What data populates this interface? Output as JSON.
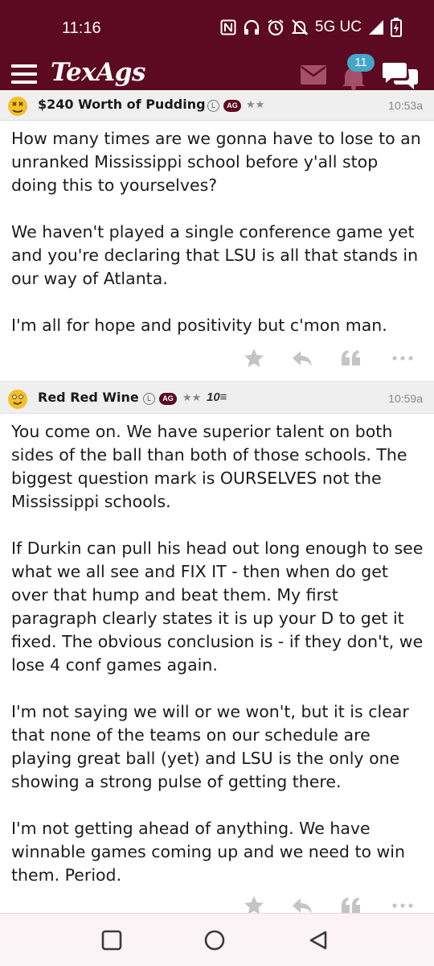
{
  "status_bar": {
    "time": "11:16",
    "network": "5G UC",
    "icons": [
      "nfc-icon",
      "headphones-icon",
      "alarm-icon",
      "mute-icon",
      "signal-icon",
      "battery-charging-icon"
    ]
  },
  "app_bar": {
    "menu_icon": "hamburger-icon",
    "logo": "TexAgs",
    "notifications_count": "11",
    "icons": [
      "mail-icon",
      "bell-icon",
      "chat-icon"
    ]
  },
  "posts": [
    {
      "username": "$240 Worth of Pudding",
      "badge_l": "L",
      "badge_ag": "AG",
      "stars": "★★",
      "time": "10:53a",
      "paragraphs": [
        "How many times are we gonna have to lose to an unranked Mississippi school before y'all stop doing this to yourselves?",
        "We haven't played a single conference game yet and you're declaring that LSU is all that stands in our way of Atlanta.",
        "I'm all for hope and positivity but c'mon man."
      ]
    },
    {
      "username": "Red Red Wine",
      "badge_l": "L",
      "badge_ag": "AG",
      "stars": "★★",
      "extra_badge": "10≡",
      "time": "10:59a",
      "paragraphs": [
        "You come on. We have superior talent on both sides of the ball than both of those schools. The biggest question mark is OURSELVES not the Mississippi schools.",
        "If Durkin can pull his head out long enough to see what we all see and FIX IT - then when do get over that hump and beat them. My first paragraph clearly states it is up your D to get it fixed. The obvious conclusion is - if they don't, we lose 4 conf games again.",
        "I'm not saying we will or we won't, but it is clear that none of the teams on our schedule are playing great ball (yet) and LSU is the only one showing a strong pulse of getting there.",
        "I'm not getting ahead of anything. We have winnable games coming up and we need to win them. Period."
      ]
    }
  ],
  "post_actions": [
    "star-icon",
    "reply-icon",
    "quote-icon",
    "more-icon"
  ],
  "nav_bar": [
    "recents-square-icon",
    "home-circle-icon",
    "back-triangle-icon"
  ],
  "colors": {
    "brand_maroon": "#5b0a22",
    "badge_blue": "#46a6c9",
    "header_gray": "#efefef"
  }
}
